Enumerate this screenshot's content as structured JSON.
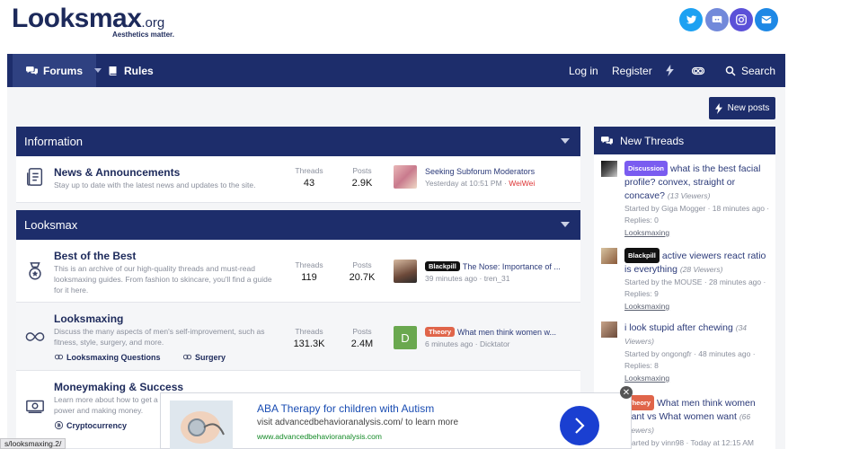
{
  "header": {
    "logo_main": "Looksmax",
    "logo_tld": ".org",
    "tagline": "Aesthetics matter.",
    "social": [
      {
        "icon": "twitter-icon",
        "color": "#1da1f2"
      },
      {
        "icon": "discord-icon",
        "color": "#7289da"
      },
      {
        "icon": "instagram-icon",
        "color": "#5b51d8"
      },
      {
        "icon": "email-icon",
        "color": "#1e88e5"
      }
    ]
  },
  "nav": {
    "forums": "Forums",
    "rules": "Rules",
    "login": "Log in",
    "register": "Register",
    "search": "Search"
  },
  "new_posts": "New posts",
  "categories": [
    {
      "title": "Information",
      "nodes": [
        {
          "title": "News & Announcements",
          "desc": "Stay up to date with the latest news and updates to the site.",
          "threads_label": "Threads",
          "threads": "43",
          "posts_label": "Posts",
          "posts": "2.9K",
          "last_title": "Seeking Subforum Moderators",
          "last_time": "Yesterday at 10:51 PM",
          "last_user": "WeiWei"
        }
      ]
    },
    {
      "title": "Looksmax",
      "nodes": [
        {
          "title": "Best of the Best",
          "desc": "This is an archive of our high-quality threads and must-read looksmaxing guides. From fashion to skincare, you'll find a guide for it here.",
          "threads_label": "Threads",
          "threads": "119",
          "posts_label": "Posts",
          "posts": "20.7K",
          "last_badge": "Blackpill",
          "last_title": "The Nose: Importance of ...",
          "last_time": "39 minutes ago",
          "last_user": "tren_31"
        },
        {
          "title": "Looksmaxing",
          "desc": "Discuss the many aspects of men's self-improvement, such as fitness, style, surgery, and more.",
          "threads_label": "Threads",
          "threads": "131.3K",
          "posts_label": "Posts",
          "posts": "2.4M",
          "last_avatar_letter": "D",
          "last_badge": "Theory",
          "last_title": "What men think women w...",
          "last_time": "6 minutes ago",
          "last_user": "Dicktator",
          "sublinks": [
            "Looksmaxing Questions",
            "Surgery"
          ]
        },
        {
          "title": "Moneymaking & Success",
          "desc": "Learn more about how to get a",
          "desc2": "power and making money.",
          "sublinks": [
            "Cryptocurrency"
          ]
        }
      ]
    }
  ],
  "sidebar": {
    "title": "New Threads",
    "threads": [
      {
        "badge": "Discussion",
        "title": "what is the best facial profile? convex, straight or concave?",
        "views": "(13 Viewers)",
        "meta": "Started by Giga Mogger · 18 minutes ago · Replies: 0",
        "forum": "Looksmaxing"
      },
      {
        "badge": "Blackpill",
        "title": "active viewers react ratio is everything",
        "views": "(28 Viewers)",
        "meta": "Started by the MOUSE · 28 minutes ago · Replies: 9",
        "forum": "Looksmaxing"
      },
      {
        "title": "i look stupid after chewing",
        "views": "(34 Viewers)",
        "meta": "Started by ongongfr · 48 minutes ago · Replies: 8",
        "forum": "Looksmaxing"
      },
      {
        "badge": "Theory",
        "title": "What men think women want vs What women want",
        "views": "(66 Viewers)",
        "meta": "Started by vinn98 · Today at 12:15 AM"
      }
    ]
  },
  "ad": {
    "title": "ABA Therapy for children with Autism",
    "desc": "visit advancedbehavioranalysis.com/ to learn more",
    "url": "www.advancedbehavioranalysis.com",
    "close": "✕"
  },
  "status_url": "s/looksmaxing.2/"
}
